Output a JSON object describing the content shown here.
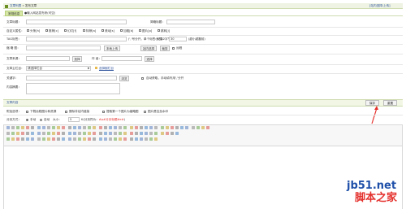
{
  "header": {
    "breadcrumb_current": "文章列表",
    "breadcrumb_sep": "»",
    "breadcrumb_section": "发布文章",
    "right_link": "[站内选择/上传]"
  },
  "tabs": [
    {
      "label": "常规信息"
    },
    {
      "label": "●输入网站发布来(可空)"
    }
  ],
  "form": {
    "title_label": "文章标题：",
    "short_title_label": "简略标题：",
    "attr_label": "自定义属性：",
    "attr_options": [
      "头条[h]",
      "推荐[c]",
      "幻灯[f]",
      "特荐[a]",
      "滚动[s]",
      "加粗[b]",
      "图片[p]",
      "跳转[j]"
    ],
    "tag_label": "TAG标签：",
    "tag_hint": "(','号分开，单个标签小于12字节)",
    "weight_label": "权重：",
    "weight_value": "30",
    "weight_hint": "(越小越靠前)",
    "thumb_label": "缩 略 图：",
    "upload_btn": "本地上传",
    "choose_btn": "站内选择",
    "crop_btn": "裁剪",
    "remote_label": "远程",
    "source_label": "文章来源：",
    "source_btn": "选择",
    "author_label": "作 者：",
    "author_btn": "选择",
    "column_label": "文章主栏目：",
    "column_value": "请选择栏目",
    "column_link": "选择副栏目",
    "keywords_label": "关键字：",
    "keywords_btn": "浏览",
    "auto_keywords_label": "自动获取，手动填写用','分开",
    "desc_label": "内容摘要："
  },
  "content": {
    "section_title": "文章内容",
    "opts_label": "附加选项：",
    "opt1": "下载远程图片和资源",
    "opt2": "删除非站内链接",
    "opt3": "提取第一个图片为缩略图",
    "opt4": "图片是否加水印",
    "page_label": "分页方式：",
    "page_manual": "手动",
    "page_auto": "自动",
    "page_size_label": "大小：",
    "page_size_value": "5",
    "page_hint": "K(分页符为：",
    "page_hint_red": "#p#分页标题#e#",
    "page_hint_end": ")",
    "save_btn": "保存",
    "reset_btn": "重置"
  },
  "watermark": {
    "site": "jb51.net",
    "name": "脚本之家"
  },
  "colors": {
    "accent": "#e4312d",
    "header_bg": "#eef3e3",
    "section_bg": "#f2f7e5",
    "tab_active": "#d6e7a6"
  }
}
